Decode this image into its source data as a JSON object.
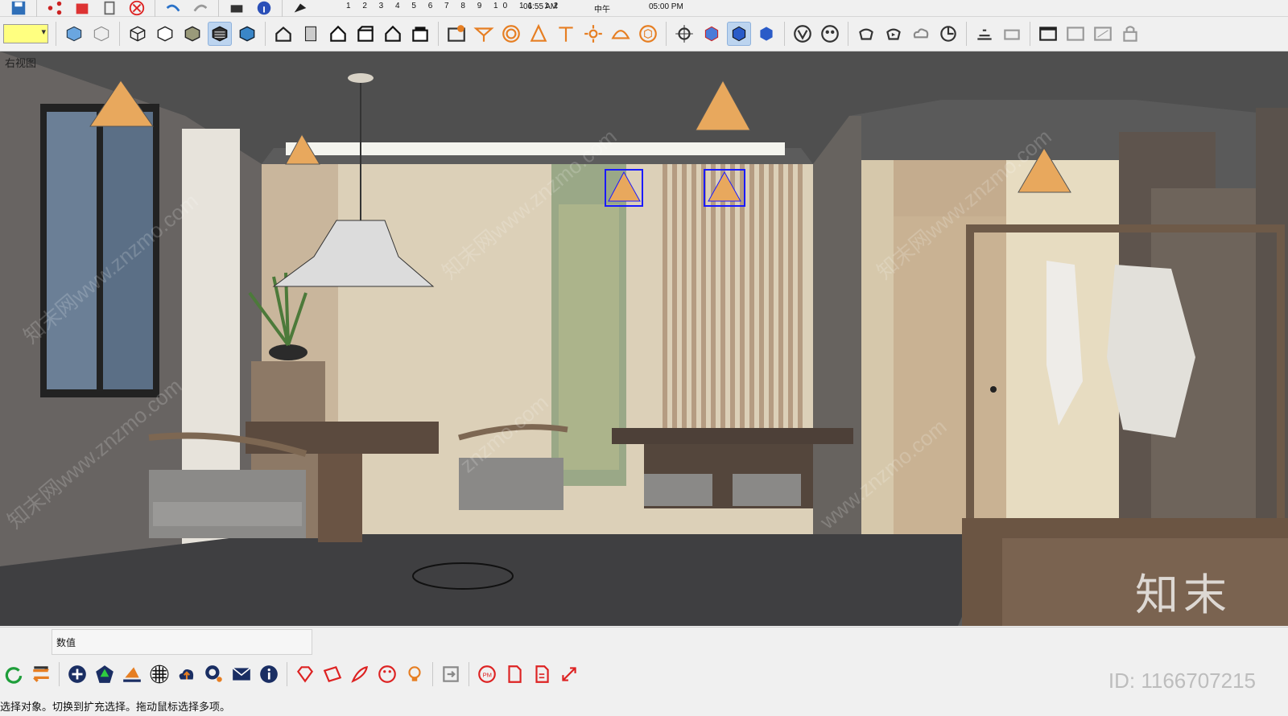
{
  "viewport": {
    "view_name": "右视图",
    "watermarks": [
      "知末网www.znzmo.com",
      "知末网www.znzmo.com",
      "znzmo.com",
      "知末网www.znzmo.com",
      "www.znzmo.com",
      "知末网www.znzmo.com"
    ],
    "logo_text": "知末"
  },
  "shadow_bar": {
    "months": "1 2 3 4 5 6 7 8 9 10 11 12",
    "time_start": "06:55 AM",
    "noon": "中午",
    "time_end": "05:00 PM"
  },
  "measurements": {
    "label": "数值"
  },
  "status_bar": {
    "text": "选择对象。切换到扩充选择。拖动鼠标选择多项。"
  },
  "file_id": "ID: 1166707215",
  "toolbar_icons_row1": [
    "save-icon",
    "share-icon",
    "warehouse-icon",
    "copy-icon",
    "stop-icon",
    "undo-icon",
    "redo-icon",
    "print-icon",
    "model-info-icon",
    "shadow-icon"
  ],
  "toolbar_icons_row2": [
    "style-xray-icon",
    "style-back-edges-icon",
    "style-wireframe-icon",
    "style-hidden-line-icon",
    "style-shaded-icon",
    "style-textured-icon",
    "style-monochrome-icon",
    "iso-view-icon",
    "top-view-icon",
    "front-view-icon",
    "right-view-icon",
    "back-view-icon",
    "left-view-icon",
    "bottom-view-icon"
  ],
  "colors": {
    "accent": "#bcd4ef",
    "ui_bg": "#f0f0f0",
    "selection": "#1a1aff"
  }
}
